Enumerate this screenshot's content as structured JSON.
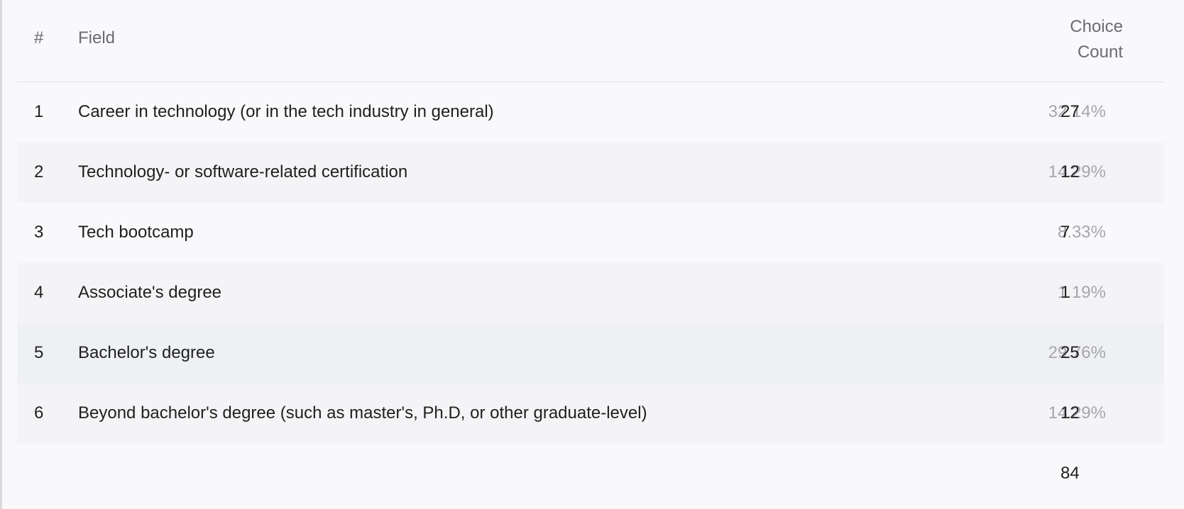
{
  "table": {
    "headers": {
      "num": "#",
      "field": "Field",
      "choice_count_line1": "Choice",
      "choice_count_line2": "Count"
    },
    "rows": [
      {
        "num": "1",
        "label": "Career in technology (or in the tech industry in general)",
        "percent": "32.14%",
        "count": "27"
      },
      {
        "num": "2",
        "label": "Technology- or software-related certification",
        "percent": "14.29%",
        "count": "12"
      },
      {
        "num": "3",
        "label": "Tech bootcamp",
        "percent": "8.33%",
        "count": "7"
      },
      {
        "num": "4",
        "label": "Associate's degree",
        "percent": "1.19%",
        "count": "1"
      },
      {
        "num": "5",
        "label": "Bachelor's degree",
        "percent": "29.76%",
        "count": "25"
      },
      {
        "num": "6",
        "label": "Beyond bachelor's degree (such as master's, Ph.D, or other graduate-level)",
        "percent": "14.29%",
        "count": "12"
      }
    ],
    "total": "84"
  },
  "colors": {
    "background": "#f9f9fb",
    "row_alt": "#f4f4f6",
    "row_highlight": "#eef0f4",
    "percent_text": "#a6a6ab",
    "header_text": "#6b6b70"
  }
}
